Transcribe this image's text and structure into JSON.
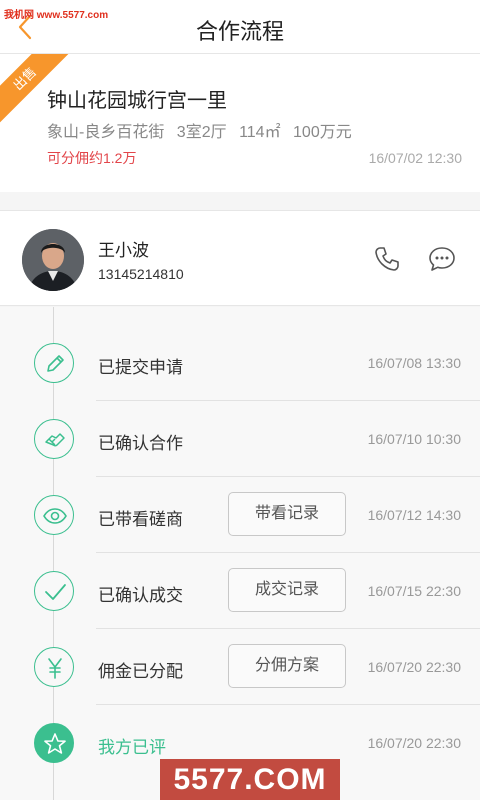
{
  "watermark": "我机网 www.5577.com",
  "header": {
    "title": "合作流程"
  },
  "property": {
    "badge": "出售",
    "title": "钟山花园城行宫一里",
    "location": "象山-良乡百花街",
    "layout": "3室2厅",
    "area": "114㎡",
    "price": "100万元",
    "commission": "可分佣约1.2万",
    "date": "16/07/02 12:30"
  },
  "agent": {
    "name": "王小波",
    "phone": "13145214810"
  },
  "steps": [
    {
      "icon": "pencil-icon",
      "label": "已提交申请",
      "date": "16/07/08 13:30",
      "button": ""
    },
    {
      "icon": "handshake-icon",
      "label": "已确认合作",
      "date": "16/07/10 10:30",
      "button": ""
    },
    {
      "icon": "eye-icon",
      "label": "已带看磋商",
      "date": "16/07/12 14:30",
      "button": "带看记录"
    },
    {
      "icon": "check-icon",
      "label": "已确认成交",
      "date": "16/07/15 22:30",
      "button": "成交记录"
    },
    {
      "icon": "yen-icon",
      "label": "佣金已分配",
      "date": "16/07/20 22:30",
      "button": "分佣方案"
    },
    {
      "icon": "star-icon",
      "label": "我方已评",
      "date": "16/07/20 22:30",
      "button": ""
    }
  ],
  "footer": {
    "logo_text": "5577.COM"
  },
  "colors": {
    "accent": "#3bbf8f",
    "orange": "#f7962c",
    "red": "#e2454a"
  }
}
